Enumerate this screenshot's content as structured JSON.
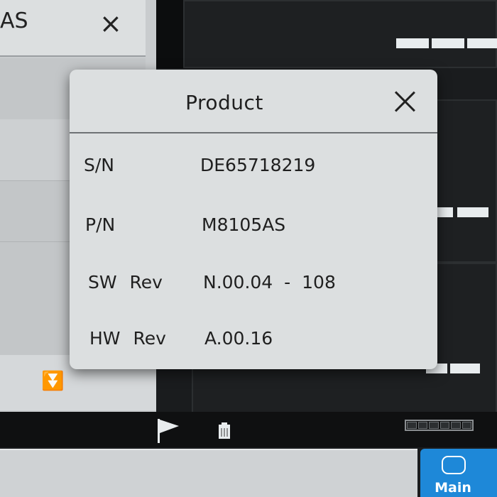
{
  "background_window": {
    "title": "AS",
    "close_glyph": "×",
    "scroll_glyph": "⏬"
  },
  "dialog": {
    "title": "Product",
    "fields": [
      {
        "label": "S/N",
        "value": "DE65718219"
      },
      {
        "label": "P/N",
        "value": "M8105AS"
      },
      {
        "label": "SW Rev",
        "value": "N.00.04 - 108"
      },
      {
        "label": "HW Rev",
        "value": "A.00.16"
      }
    ]
  },
  "status_bar": {
    "icons": [
      "flag-icon",
      "battery-icon",
      "signal-meter"
    ]
  },
  "main_button": {
    "label": "Main",
    "color": "#1e88d8"
  }
}
